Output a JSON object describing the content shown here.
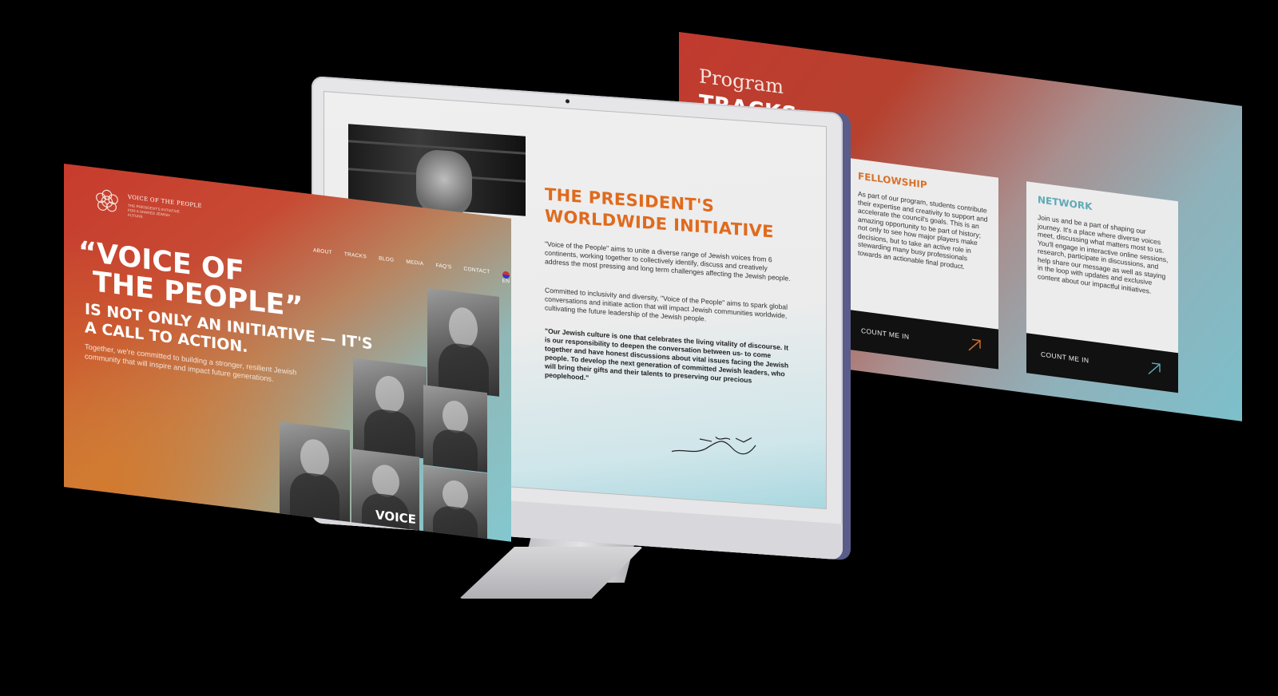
{
  "tracks": {
    "title_top": "Program",
    "title_main": "TRACKS",
    "cards": [
      {
        "name": "FELLOWSHIP",
        "description": "As part of our program, students contribute their expertise and creativity to support and accelerate the council's goals. This is an amazing opportunity to be part of history; not only to see how major players make decisions, but to take an active role in stewarding many busy professionals towards an actionable final product.",
        "cta": "COUNT ME IN",
        "accent": "#d8722c"
      },
      {
        "name": "NETWORK",
        "description": "Join us and be a part of shaping our journey. It's a place where diverse voices meet, discussing what matters most to us. You'll engage in interactive online sessions, research, participate in discussions, and help share our message as well as staying in the loop with updates and exclusive content about our impactful initiatives.",
        "cta": "COUNT ME IN",
        "accent": "#5fa9b6"
      }
    ]
  },
  "monitor": {
    "title_line1": "THE PRESIDENT'S",
    "title_line2": "WORLDWIDE INITIATIVE",
    "paragraph1": "\"Voice of the People\" aims to unite a diverse range of Jewish voices from 6 continents, working together to collectively identify, discuss and creatively address the most pressing and long term challenges affecting the Jewish people.",
    "paragraph2": "Committed to inclusivity and diversity, \"Voice of the People\" aims to spark global conversations and initiate action that will impact Jewish communities worldwide, cultivating the future leadership of the Jewish people.",
    "quote": "\"Our Jewish culture is one that celebrates the living vitality of discourse. It is our responsibility to deepen the conversation between us- to come together and have honest discussions about vital issues facing the Jewish people. To develop the next generation of committed Jewish leaders, who will bring their gifts and their talents to preserving our precious peoplehood.\"",
    "accent": "#e06a1d"
  },
  "hero": {
    "logo_title": "VOICE OF THE PEOPLE",
    "logo_subtitle": "THE PRESIDENT'S INITIATIVE FOR A SHARED JEWISH FUTURE",
    "nav": [
      "ABOUT",
      "TRACKS",
      "BLOG",
      "MEDIA",
      "FAQ'S",
      "CONTACT"
    ],
    "language": "EN",
    "headline_line1": "“VOICE OF",
    "headline_line2": "THE PEOPLE”",
    "subheadline": "IS NOT ONLY AN INITIATIVE — IT'S A CALL TO ACTION.",
    "body": "Together, we're committed to building a stronger, resilient Jewish community that will inspire and impact future generations.",
    "overlay_text": "VOICE"
  }
}
